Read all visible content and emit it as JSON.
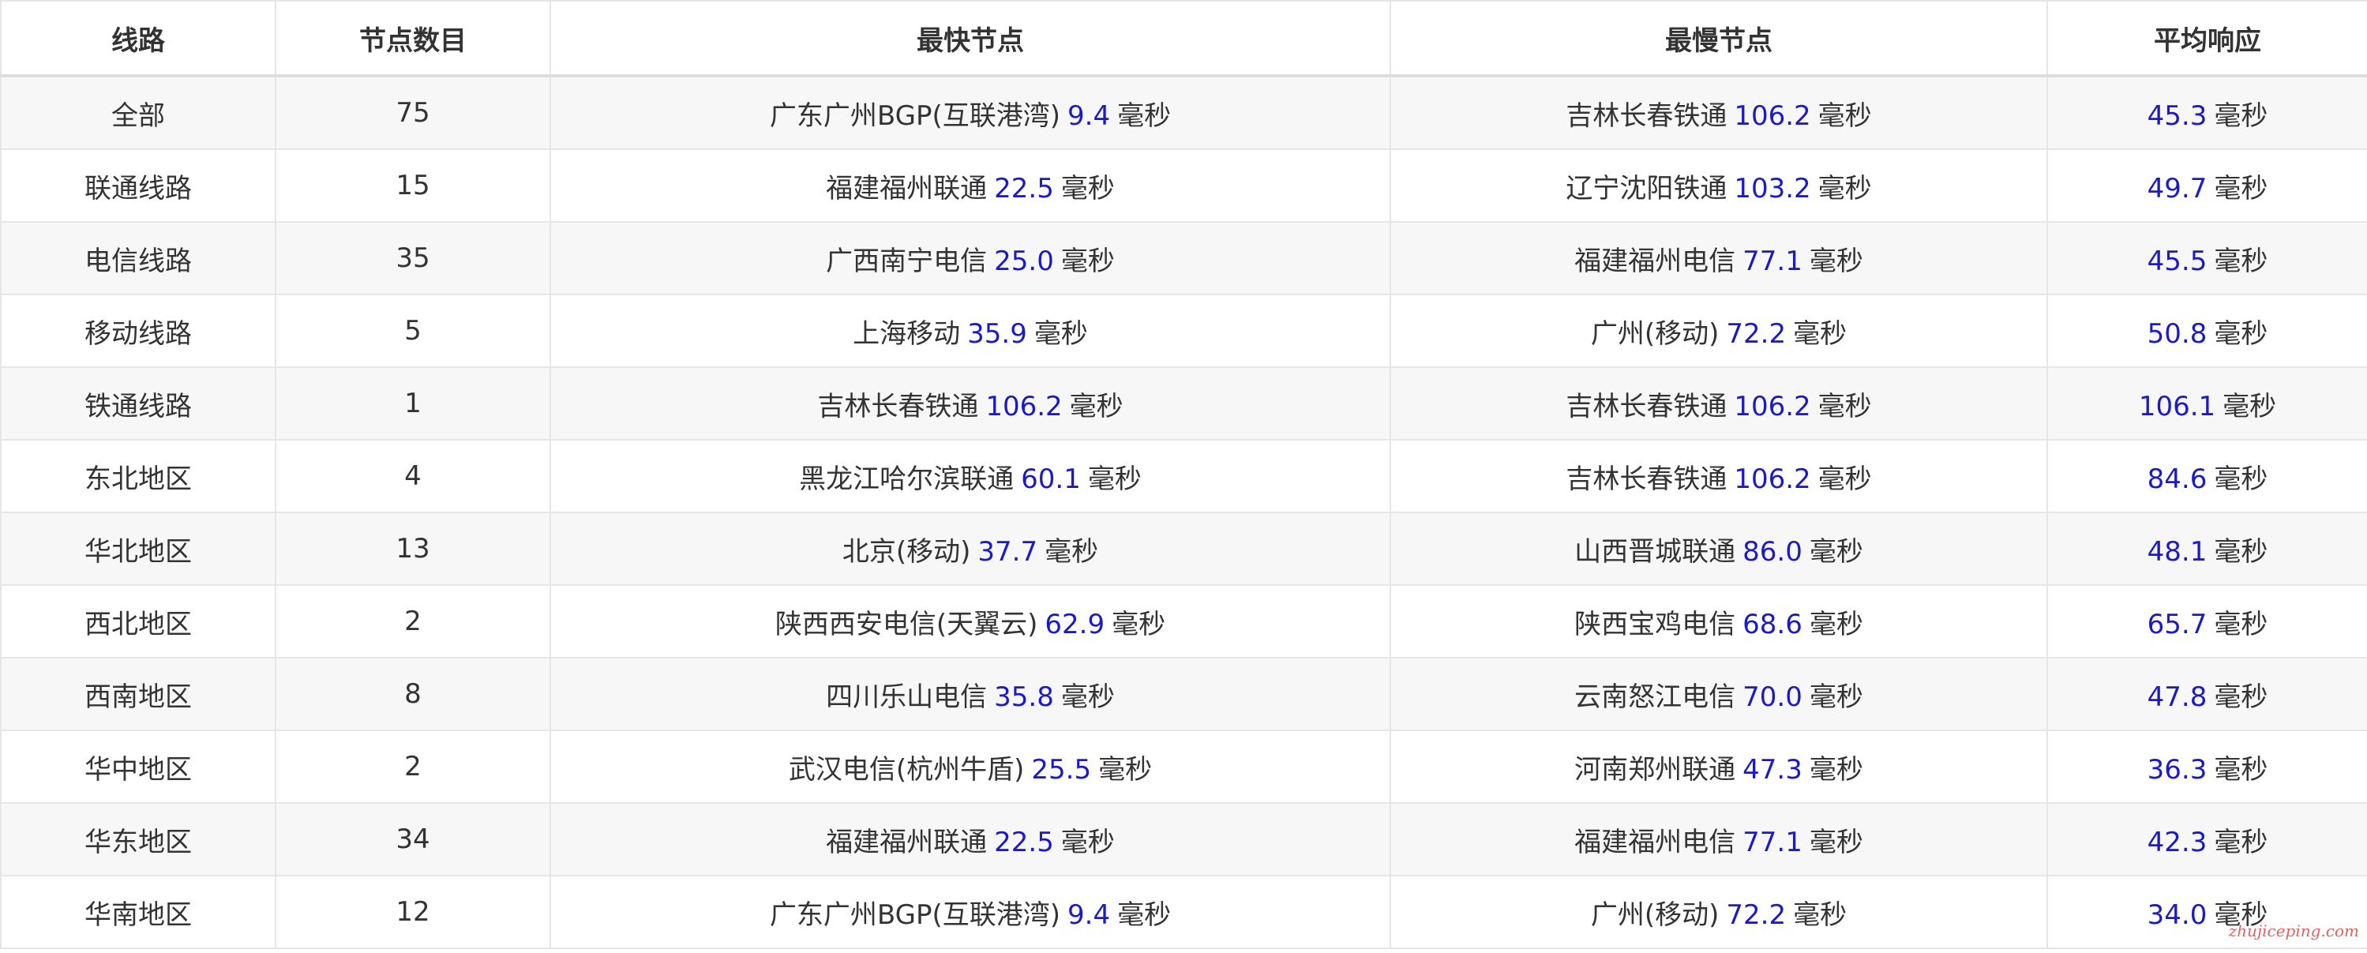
{
  "table": {
    "headers": [
      "线路",
      "节点数目",
      "最快节点",
      "最慢节点",
      "平均响应"
    ],
    "unit": "毫秒",
    "rows": [
      {
        "line": "全部",
        "count": "75",
        "fast_name": "广东广州BGP(互联港湾)",
        "fast_ms": "9.4",
        "slow_name": "吉林长春铁通",
        "slow_ms": "106.2",
        "avg_ms": "45.3"
      },
      {
        "line": "联通线路",
        "count": "15",
        "fast_name": "福建福州联通",
        "fast_ms": "22.5",
        "slow_name": "辽宁沈阳铁通",
        "slow_ms": "103.2",
        "avg_ms": "49.7"
      },
      {
        "line": "电信线路",
        "count": "35",
        "fast_name": "广西南宁电信",
        "fast_ms": "25.0",
        "slow_name": "福建福州电信",
        "slow_ms": "77.1",
        "avg_ms": "45.5"
      },
      {
        "line": "移动线路",
        "count": "5",
        "fast_name": "上海移动",
        "fast_ms": "35.9",
        "slow_name": "广州(移动)",
        "slow_ms": "72.2",
        "avg_ms": "50.8"
      },
      {
        "line": "铁通线路",
        "count": "1",
        "fast_name": "吉林长春铁通",
        "fast_ms": "106.2",
        "slow_name": "吉林长春铁通",
        "slow_ms": "106.2",
        "avg_ms": "106.1"
      },
      {
        "line": "东北地区",
        "count": "4",
        "fast_name": "黑龙江哈尔滨联通",
        "fast_ms": "60.1",
        "slow_name": "吉林长春铁通",
        "slow_ms": "106.2",
        "avg_ms": "84.6"
      },
      {
        "line": "华北地区",
        "count": "13",
        "fast_name": "北京(移动)",
        "fast_ms": "37.7",
        "slow_name": "山西晋城联通",
        "slow_ms": "86.0",
        "avg_ms": "48.1"
      },
      {
        "line": "西北地区",
        "count": "2",
        "fast_name": "陕西西安电信(天翼云)",
        "fast_ms": "62.9",
        "slow_name": "陕西宝鸡电信",
        "slow_ms": "68.6",
        "avg_ms": "65.7"
      },
      {
        "line": "西南地区",
        "count": "8",
        "fast_name": "四川乐山电信",
        "fast_ms": "35.8",
        "slow_name": "云南怒江电信",
        "slow_ms": "70.0",
        "avg_ms": "47.8"
      },
      {
        "line": "华中地区",
        "count": "2",
        "fast_name": "武汉电信(杭州牛盾)",
        "fast_ms": "25.5",
        "slow_name": "河南郑州联通",
        "slow_ms": "47.3",
        "avg_ms": "36.3"
      },
      {
        "line": "华东地区",
        "count": "34",
        "fast_name": "福建福州联通",
        "fast_ms": "22.5",
        "slow_name": "福建福州电信",
        "slow_ms": "77.1",
        "avg_ms": "42.3"
      },
      {
        "line": "华南地区",
        "count": "12",
        "fast_name": "广东广州BGP(互联港湾)",
        "fast_ms": "9.4",
        "slow_name": "广州(移动)",
        "slow_ms": "72.2",
        "avg_ms": "34.0"
      }
    ]
  },
  "watermark": "zhujiceping.com",
  "colors": {
    "number": "#1a1ac8",
    "text": "#333333",
    "stripe": "#f7f7f7",
    "border": "#e6e6e6",
    "watermark": "#d9534f"
  }
}
